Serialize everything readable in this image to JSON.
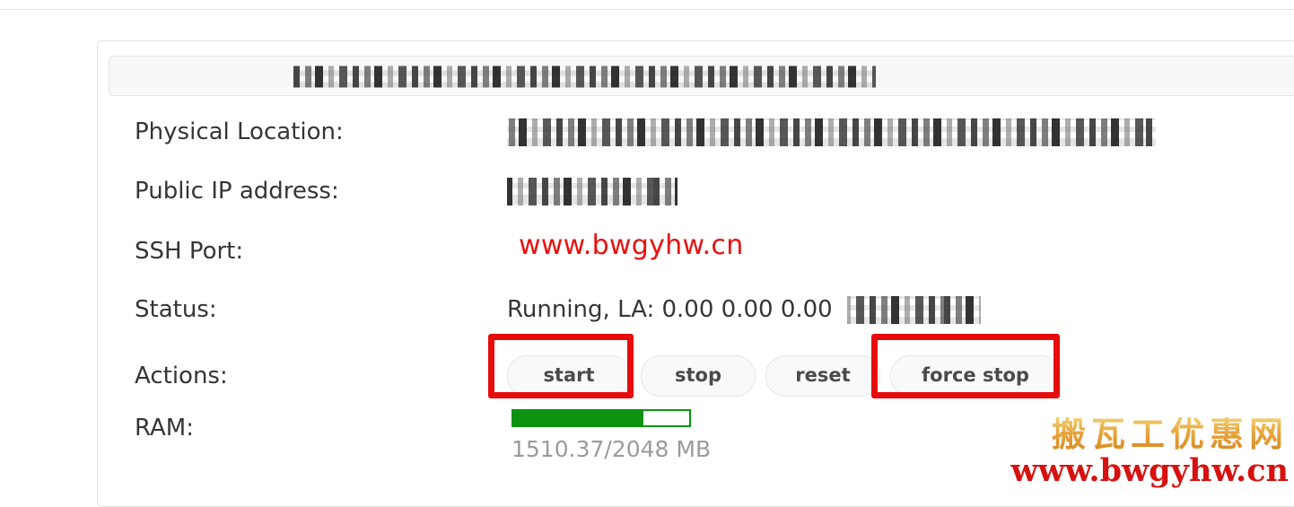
{
  "panel": {
    "header_title": "REDACTED_VPS  |  HOSTNAME-LOCATION-SERVER  KVM",
    "header_redacted": true
  },
  "rows": [
    {
      "key": "physical_location",
      "label": "Physical Location:",
      "value": "REDACTED, Location  Data Center, USA   DC-XX 1.11.XXX",
      "redacted": true
    },
    {
      "key": "public_ip",
      "label": "Public IP address:",
      "value": "11.11.111.111",
      "redacted": true
    },
    {
      "key": "ssh_port",
      "label": "SSH Port:",
      "value": "",
      "overlay_watermark": "www.bwgyhw.cn",
      "redacted": true
    },
    {
      "key": "status",
      "label": "Status:",
      "value_visible": "Running, LA: 0.00 0.00 0.00",
      "value_redacted": "uptime info",
      "redacted": true
    },
    {
      "key": "actions",
      "label": "Actions:"
    },
    {
      "key": "ram",
      "label": "RAM:"
    }
  ],
  "actions": {
    "buttons": [
      {
        "id": "start",
        "label": "start",
        "highlighted": true
      },
      {
        "id": "stop",
        "label": "stop",
        "highlighted": false
      },
      {
        "id": "reset",
        "label": "reset",
        "highlighted": false
      },
      {
        "id": "force_stop",
        "label": "force stop",
        "highlighted": true
      }
    ],
    "highlight_color": "#e60c0c"
  },
  "ram": {
    "used_mb": 1510.37,
    "total_mb": 2048,
    "percent": 73.75,
    "text": "1510.37/2048 MB",
    "bar_color": "#0e9211"
  },
  "watermarks": {
    "inline_url": "www.bwgyhw.cn",
    "inline_url_color": "#e8110f",
    "corner_cn": "搬瓦工优惠网",
    "corner_cn_color": "#e0a73e",
    "corner_url": "www.bwgyhw.cn",
    "corner_url_color": "#d6110f"
  }
}
